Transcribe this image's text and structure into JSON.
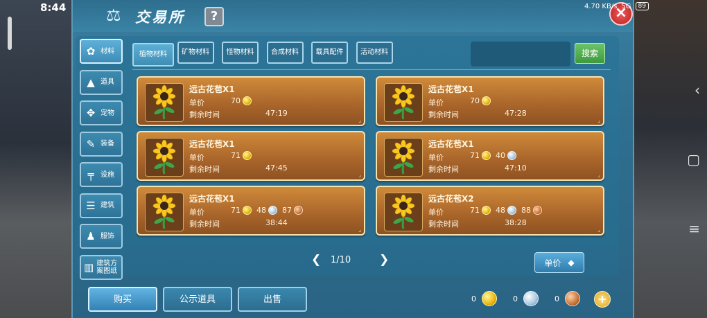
{
  "status": {
    "time": "8:44",
    "net": "4.70 KB/s",
    "signal": "5G",
    "battery": "89"
  },
  "window": {
    "title": "交易所",
    "help": "?",
    "close": "×"
  },
  "categories": [
    {
      "label": "材料",
      "icon": "flower-cluster-icon",
      "glyph": "✿",
      "active": true
    },
    {
      "label": "道具",
      "icon": "potion-icon",
      "glyph": "▲",
      "active": false
    },
    {
      "label": "宠物",
      "icon": "paw-icon",
      "glyph": "✥",
      "active": false
    },
    {
      "label": "装备",
      "icon": "sword-icon",
      "glyph": "✎",
      "active": false
    },
    {
      "label": "设施",
      "icon": "table-icon",
      "glyph": "╤",
      "active": false
    },
    {
      "label": "建筑",
      "icon": "building-icon",
      "glyph": "☰",
      "active": false
    },
    {
      "label": "服饰",
      "icon": "shirt-icon",
      "glyph": "♟",
      "active": false
    },
    {
      "label": "建筑方案图纸",
      "icon": "blueprint-icon",
      "glyph": "▥",
      "active": false
    }
  ],
  "tabs": [
    {
      "label": "植物材料",
      "active": true
    },
    {
      "label": "矿物材料",
      "active": false
    },
    {
      "label": "怪物材料",
      "active": false
    },
    {
      "label": "合成材料",
      "active": false
    },
    {
      "label": "载具配件",
      "active": false
    },
    {
      "label": "活动材料",
      "active": false
    }
  ],
  "search": {
    "placeholder": "",
    "button": "搜索"
  },
  "listing_labels": {
    "price": "单价",
    "remaining": "剩余时间"
  },
  "listings": [
    {
      "name": "远古花苞X1",
      "gold": "70",
      "silver": "",
      "copper": "",
      "time": "47:19"
    },
    {
      "name": "远古花苞X1",
      "gold": "70",
      "silver": "",
      "copper": "",
      "time": "47:28"
    },
    {
      "name": "远古花苞X1",
      "gold": "71",
      "silver": "",
      "copper": "",
      "time": "47:45"
    },
    {
      "name": "远古花苞X1",
      "gold": "71",
      "silver": "40",
      "copper": "",
      "time": "47:10"
    },
    {
      "name": "远古花苞X1",
      "gold": "71",
      "silver": "48",
      "copper": "87",
      "time": "38:44"
    },
    {
      "name": "远古花苞X2",
      "gold": "71",
      "silver": "48",
      "copper": "88",
      "time": "38:28"
    }
  ],
  "pager": {
    "text": "1/10",
    "prev": "❮",
    "next": "❯"
  },
  "sort_button": {
    "label": "单价"
  },
  "bottom": {
    "buy": "购买",
    "public": "公示道具",
    "sell": "出售"
  },
  "wallet": {
    "gold": "0",
    "silver": "0",
    "copper": "0"
  }
}
